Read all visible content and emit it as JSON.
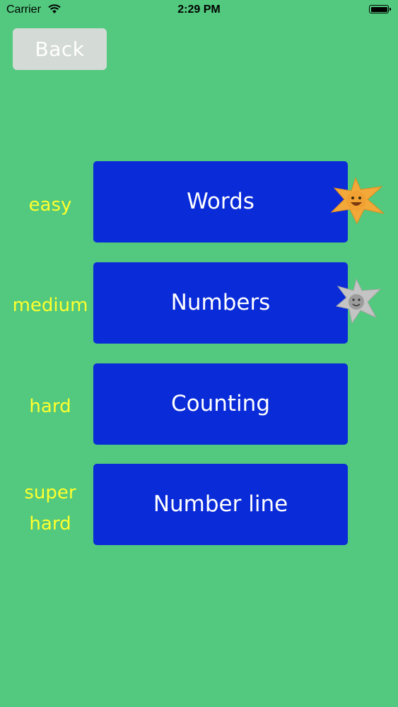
{
  "status_bar": {
    "carrier": "Carrier",
    "time": "2:29 PM"
  },
  "back_button": {
    "label": "Back"
  },
  "colors": {
    "background": "#52c97e",
    "button": "#0a2bd8",
    "level_text": "#ffff2e",
    "gold_star": "#f3a93a",
    "silver_star": "#bfbfbf"
  },
  "levels": [
    {
      "difficulty": "easy",
      "label": "Words",
      "award": "gold-star-icon"
    },
    {
      "difficulty": "medium",
      "label": "Numbers",
      "award": "silver-star-icon"
    },
    {
      "difficulty": "hard",
      "label": "Counting",
      "award": ""
    },
    {
      "difficulty_line1": "super",
      "difficulty_line2": "hard",
      "label": "Number line",
      "award": ""
    }
  ]
}
